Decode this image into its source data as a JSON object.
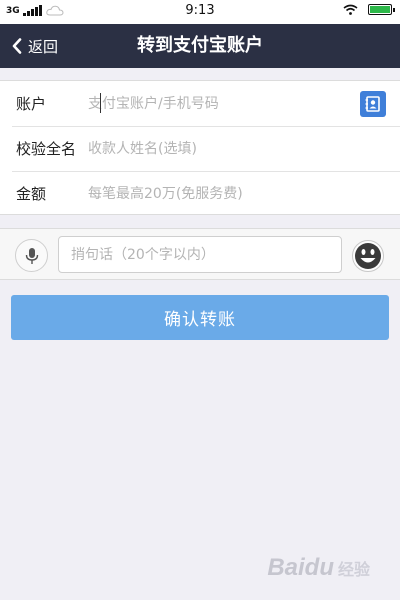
{
  "status_bar": {
    "network": "3G",
    "time": "9:13",
    "battery_level": 1.0
  },
  "nav": {
    "back_label": "返回",
    "title": "转到支付宝账户"
  },
  "form": {
    "account": {
      "label": "账户",
      "placeholder": "支付宝账户/手机号码"
    },
    "verify_name": {
      "label": "校验全名",
      "placeholder": "收款人姓名(选填)"
    },
    "amount": {
      "label": "金额",
      "placeholder": "每笔最高20万(免服务费)"
    }
  },
  "message": {
    "placeholder": "捎句话（20个字以内）"
  },
  "confirm_label": "确认转账",
  "watermark": {
    "brand": "Baidu",
    "sub": "经验"
  },
  "colors": {
    "nav_background": "#2b3044",
    "confirm_button": "#6aaae8",
    "contact_icon": "#3f7fd9",
    "page_background": "#f0eff5"
  },
  "icons": [
    "signal-icon",
    "cloud-icon",
    "wifi-icon",
    "battery-icon",
    "back-chevron-icon",
    "contact-book-icon",
    "microphone-icon",
    "emoji-icon"
  ]
}
